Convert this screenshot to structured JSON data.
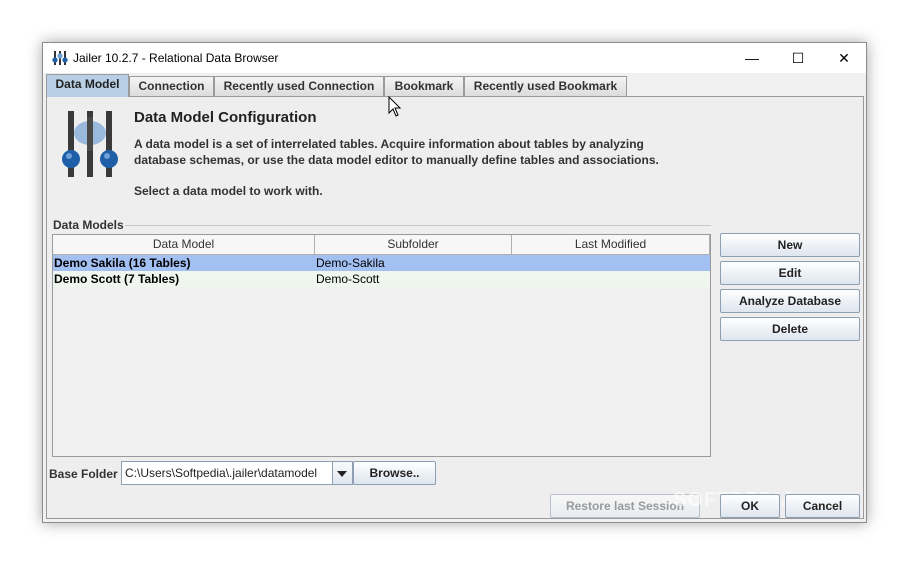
{
  "window": {
    "title": "Jailer 10.2.7 - Relational Data Browser",
    "minimize_glyph": "—",
    "maximize_glyph": "☐",
    "close_glyph": "✕"
  },
  "tabs": [
    {
      "label": "Data Model",
      "active": true
    },
    {
      "label": "Connection",
      "active": false
    },
    {
      "label": "Recently used Connection",
      "active": false
    },
    {
      "label": "Bookmark",
      "active": false
    },
    {
      "label": "Recently used Bookmark",
      "active": false
    }
  ],
  "header": {
    "title": "Data Model Configuration",
    "description_line1": "A data model is a set of interrelated tables. Acquire information about tables by analyzing",
    "description_line2": "database schemas, or use the data model editor to manually define tables and associations.",
    "hint": "Select a data model to work with."
  },
  "models": {
    "group_label": "Data Models",
    "columns": [
      "Data Model",
      "Subfolder",
      "Last Modified"
    ],
    "rows": [
      {
        "name": "Demo Sakila (16 Tables)",
        "subfolder": "Demo-Sakila",
        "last_modified": "",
        "selected": true
      },
      {
        "name": "Demo Scott (7 Tables)",
        "subfolder": "Demo-Scott",
        "last_modified": "",
        "selected": false
      }
    ]
  },
  "side_buttons": {
    "new": "New",
    "edit": "Edit",
    "analyze": "Analyze Database",
    "delete": "Delete"
  },
  "base_folder": {
    "label": "Base Folder",
    "value": "C:\\Users\\Softpedia\\.jailer\\datamodel",
    "browse": "Browse.."
  },
  "footer": {
    "restore": "Restore last Session",
    "ok": "OK",
    "cancel": "Cancel"
  },
  "watermark": "SOFTPEDIA",
  "colors": {
    "selection": "#a3c0f2",
    "active_tab": "#b8cfe5",
    "sphere": "#1f5fa8"
  },
  "icons": {
    "app": "jailer-sliders-icon",
    "hero": "jailer-logo-icon",
    "cursor": "mouse-pointer-icon",
    "combo": "chevron-down-icon"
  }
}
